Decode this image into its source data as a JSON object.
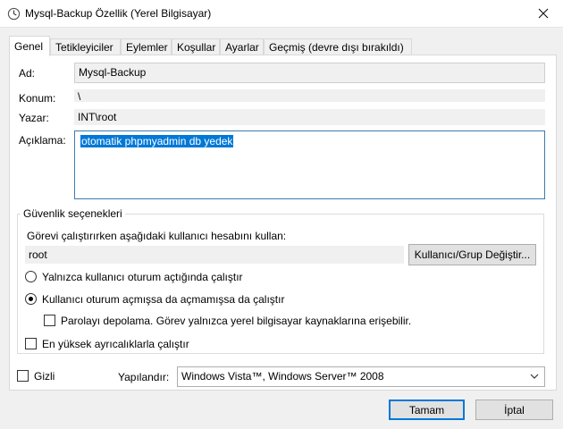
{
  "window": {
    "title": "Mysql-Backup Özellik (Yerel Bilgisayar)"
  },
  "tabs": [
    {
      "label": "Genel"
    },
    {
      "label": "Tetikleyiciler"
    },
    {
      "label": "Eylemler"
    },
    {
      "label": "Koşullar"
    },
    {
      "label": "Ayarlar"
    },
    {
      "label": "Geçmiş (devre dışı bırakıldı)"
    }
  ],
  "general": {
    "name_label": "Ad:",
    "name_value": "Mysql-Backup",
    "location_label": "Konum:",
    "location_value": "\\",
    "author_label": "Yazar:",
    "author_value": "INT\\root",
    "description_label": "Açıklama:",
    "description_value": "otomatik phpmyadmin db yedek"
  },
  "security": {
    "group_title": "Güvenlik seçenekleri",
    "account_prompt": "Görevi çalıştırırken aşağıdaki kullanıcı hesabını kullan:",
    "account_value": "root",
    "change_user_button": "Kullanıcı/Grup Değiştir...",
    "radio_logged_on": "Yalnızca kullanıcı oturum açtığında çalıştır",
    "radio_logged_on_selected": false,
    "radio_whether_or_not": "Kullanıcı oturum açmışsa da açmamışsa da çalıştır",
    "radio_whether_or_not_selected": true,
    "no_store_password": "Parolayı depolama. Görev yalnızca yerel bilgisayar kaynaklarına erişebilir.",
    "no_store_password_checked": false,
    "highest_privileges": "En yüksek ayrıcalıklarla çalıştır",
    "highest_privileges_checked": false
  },
  "bottom": {
    "hidden_label": "Gizli",
    "hidden_checked": false,
    "configure_label": "Yapılandır:",
    "configure_value": "Windows Vista™, Windows Server™ 2008"
  },
  "buttons": {
    "ok": "Tamam",
    "cancel": "İptal"
  },
  "colors": {
    "accent": "#0078d7",
    "selection": "#0078d7"
  }
}
